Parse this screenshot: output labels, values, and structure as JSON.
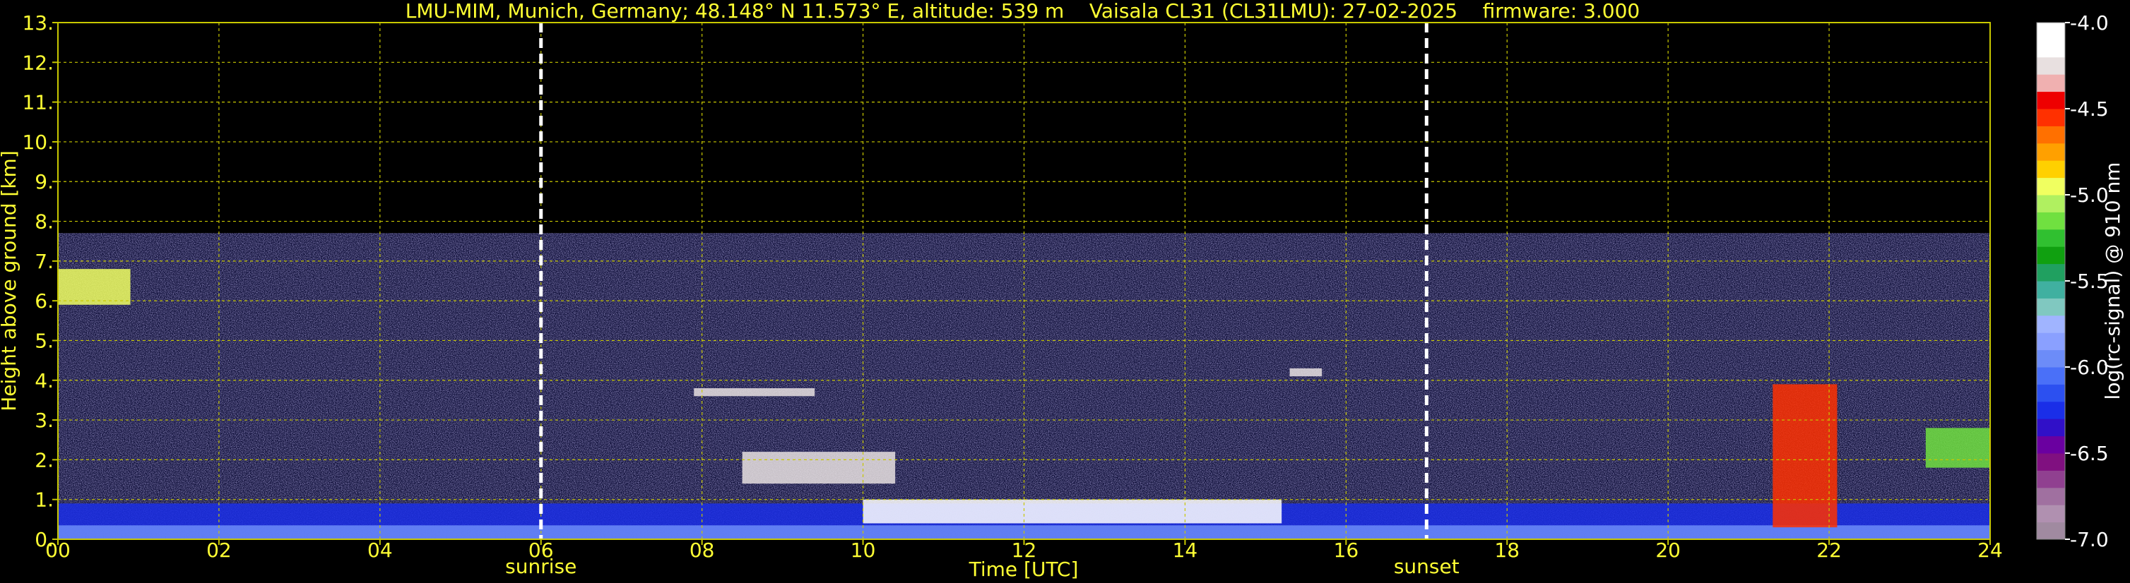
{
  "title": "LMU-MIM, Munich, Germany; 48.148° N 11.573° E, altitude: 539 m    Vaisala CL31 (CL31LMU): 27-02-2025    firmware: 3.000",
  "colors": {
    "background": "#000000",
    "text": "#ffff33",
    "grid": "#c8c800",
    "event_line": "#ffffff"
  },
  "chart_data": {
    "type": "heatmap",
    "title": "LMU-MIM, Munich, Germany; 48.148° N 11.573° E, altitude: 539 m    Vaisala CL31 (CL31LMU): 27-02-2025    firmware: 3.000",
    "xlabel": "Time [UTC]",
    "ylabel": "Height above ground [km]",
    "xlim": [
      0,
      24
    ],
    "ylim": [
      0,
      13
    ],
    "x_ticks": [
      "00",
      "02",
      "04",
      "06",
      "08",
      "10",
      "12",
      "14",
      "16",
      "18",
      "20",
      "22",
      "24"
    ],
    "y_ticks": [
      "0.",
      "1.",
      "2.",
      "3.",
      "4.",
      "5.",
      "6.",
      "7.",
      "8.",
      "9.",
      "10.",
      "11.",
      "12.",
      "13."
    ],
    "grid": true,
    "events": [
      {
        "label": "sunrise",
        "time": 6.0
      },
      {
        "label": "sunset",
        "time": 17.0
      }
    ],
    "signal_top_km": 7.7,
    "colorbar": {
      "label": "log(rc-signal) @ 910 nm",
      "min": -7.0,
      "max": -4.0,
      "ticks": [
        "-4.0",
        "-4.5",
        "-5.0",
        "-5.5",
        "-6.0",
        "-6.5",
        "-7.0"
      ],
      "colors": [
        "#a08aa0",
        "#b090b0",
        "#a070a0",
        "#904090",
        "#801080",
        "#6a00a0",
        "#3010c8",
        "#1a2ee8",
        "#2c50f0",
        "#4a70f8",
        "#6c8cf8",
        "#8aa0ff",
        "#a0b4ff",
        "#80c8c0",
        "#40b0a0",
        "#20a060",
        "#10a010",
        "#30c030",
        "#70e040",
        "#b0f060",
        "#f0ff60",
        "#ffd000",
        "#ffa000",
        "#ff7000",
        "#ff3000",
        "#ee0000",
        "#f0b0b0",
        "#e8e0e0",
        "#ffffff",
        "#ffffff"
      ]
    },
    "features": [
      {
        "name": "surface-aerosol-layer",
        "t0": 0,
        "t1": 24,
        "h0": 0,
        "h1": 0.9,
        "value": -6.2
      },
      {
        "name": "near-surface-layer",
        "t0": 0,
        "t1": 24,
        "h0": 0,
        "h1": 0.35,
        "value": -5.9
      },
      {
        "name": "high-cloud-early",
        "t0": 0.0,
        "t1": 0.9,
        "h0": 5.9,
        "h1": 6.8,
        "value": -5.0
      },
      {
        "name": "cloud-3.7km",
        "t0": 7.9,
        "t1": 9.4,
        "h0": 3.6,
        "h1": 3.8,
        "value": -4.2
      },
      {
        "name": "cloud-2km",
        "t0": 8.5,
        "t1": 10.4,
        "h0": 1.4,
        "h1": 2.2,
        "value": -4.2
      },
      {
        "name": "cloud-base-midday",
        "t0": 10.0,
        "t1": 15.2,
        "h0": 0.4,
        "h1": 1.0,
        "value": -4.1
      },
      {
        "name": "cloud-4.2km",
        "t0": 15.3,
        "t1": 15.7,
        "h0": 4.1,
        "h1": 4.3,
        "value": -4.3
      },
      {
        "name": "virga-22h",
        "t0": 21.3,
        "t1": 22.1,
        "h0": 0.3,
        "h1": 3.9,
        "value": -4.6
      },
      {
        "name": "cloud-2.8km",
        "t0": 23.2,
        "t1": 24,
        "h0": 1.8,
        "h1": 2.8,
        "value": -5.2
      }
    ]
  }
}
